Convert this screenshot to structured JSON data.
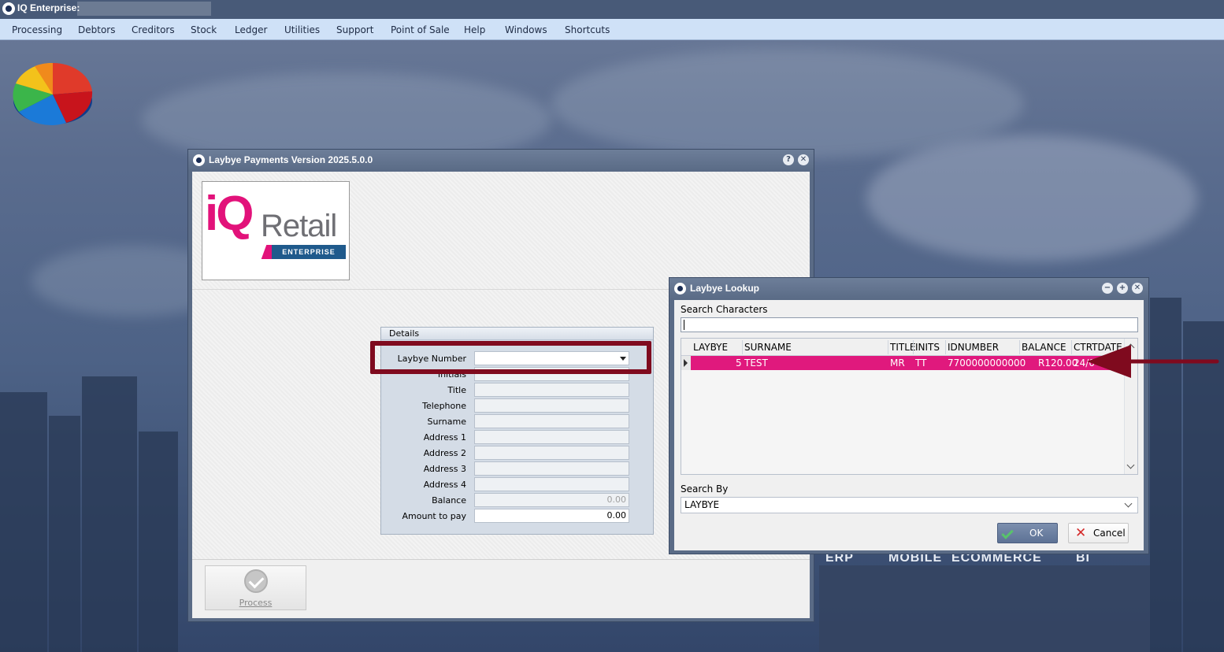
{
  "app": {
    "title": "IQ Enterprise:"
  },
  "menu": {
    "items": [
      "Processing",
      "Debtors",
      "Creditors",
      "Stock",
      "Ledger",
      "Utilities",
      "Support",
      "Point of Sale",
      "Help",
      "Windows",
      "Shortcuts"
    ]
  },
  "desktop": {
    "brand_words": [
      "ERP",
      "MOBILE",
      "ECOMMERCE",
      "BI"
    ]
  },
  "main_window": {
    "title": "Laybye Payments Version 2025.5.0.0",
    "logo": {
      "brand_text": "iQ",
      "product_text": "Retail",
      "edition_text": "ENTERPRISE"
    },
    "details": {
      "header": "Details",
      "fields": [
        {
          "label": "Laybye Number",
          "value": ""
        },
        {
          "label": "Initials",
          "value": ""
        },
        {
          "label": "Title",
          "value": ""
        },
        {
          "label": "Telephone",
          "value": ""
        },
        {
          "label": "Surname",
          "value": ""
        },
        {
          "label": "Address 1",
          "value": ""
        },
        {
          "label": "Address 2",
          "value": ""
        },
        {
          "label": "Address 3",
          "value": ""
        },
        {
          "label": "Address 4",
          "value": ""
        },
        {
          "label": "Balance",
          "value": "0.00"
        },
        {
          "label": "Amount to pay",
          "value": "0.00"
        }
      ]
    },
    "process_label": "Process",
    "help_button": "?",
    "close_button": "✕"
  },
  "lookup": {
    "title": "Laybye Lookup",
    "search_label": "Search Characters",
    "search_value": "",
    "columns": [
      "LAYBYE",
      "SURNAME",
      "TITLE",
      "INITS",
      "IDNUMBER",
      "BALANCE",
      "CTRTDATE"
    ],
    "rows": [
      {
        "laybye": "5",
        "surname": "TEST",
        "title": "MR",
        "inits": "TT",
        "idnumber": "7700000000000",
        "balance": "R120.00",
        "ctrtdate": "24/0"
      }
    ],
    "search_by_label": "Search By",
    "search_by_value": "LAYBYE",
    "ok_label": "OK",
    "cancel_label": "Cancel",
    "min_button": "−",
    "max_button": "+",
    "close_button": "✕"
  },
  "colors": {
    "selected_row": "#e0197d",
    "annotation": "#7f0a1e",
    "menu_bg": "#cfe1f7"
  }
}
